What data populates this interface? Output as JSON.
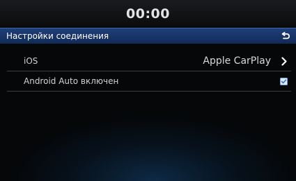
{
  "status_bar": {
    "clock": "00:00"
  },
  "header": {
    "title": "Настройки соединения",
    "back_icon": "back-arrow-icon"
  },
  "settings": {
    "ios": {
      "label": "iOS",
      "value": "Apple CarPlay",
      "icon": "chevron-right-icon"
    },
    "android": {
      "label": "Android Auto включен",
      "checked": true,
      "icon": "checkbox-checked-icon"
    }
  },
  "colors": {
    "header_bg": "#1a3770",
    "accent_blue": "#4f8fe6",
    "text": "#e0e0e0"
  }
}
